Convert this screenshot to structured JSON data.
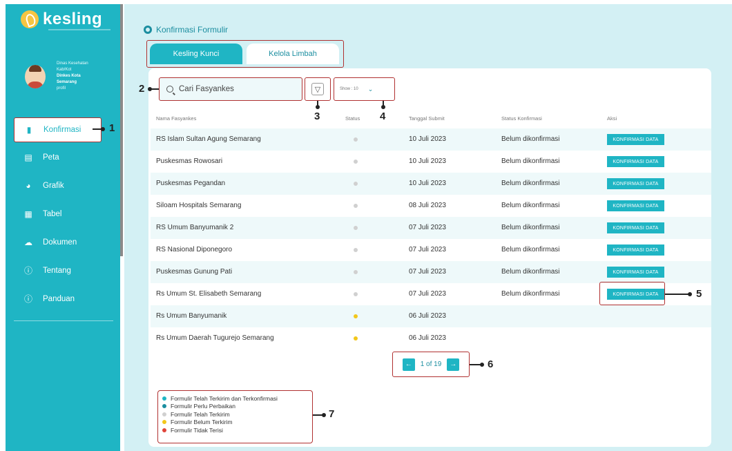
{
  "colors": {
    "accent": "#1fb5c4",
    "callout": "#b03030",
    "status_grey": "#d0d0d0",
    "status_yellow": "#f2c71b",
    "status_red": "#e0443a",
    "status_teal": "#1fb5c4"
  },
  "app": {
    "logo_text": "kesling"
  },
  "profile": {
    "line1": "Dinas Kesehatan",
    "line2": "Kab/Kot",
    "line3": "Dinkes Kota",
    "line4": "Semarang",
    "line5": "profil"
  },
  "sidebar": {
    "items": [
      {
        "label": "Konfirmasi",
        "icon": "confirm-icon"
      },
      {
        "label": "Peta",
        "icon": "map-icon"
      },
      {
        "label": "Grafik",
        "icon": "chart-icon"
      },
      {
        "label": "Tabel",
        "icon": "table-icon"
      },
      {
        "label": "Dokumen",
        "icon": "document-icon"
      },
      {
        "label": "Tentang",
        "icon": "info-icon"
      },
      {
        "label": "Panduan",
        "icon": "info-icon"
      }
    ]
  },
  "page": {
    "title": "Konfirmasi Formulir"
  },
  "tabs": [
    {
      "label": "Kesling Kunci"
    },
    {
      "label": "Kelola Limbah"
    }
  ],
  "search": {
    "placeholder": "Cari Fasyankes"
  },
  "show_select": {
    "value": "Show : 10"
  },
  "table": {
    "headers": [
      "Nama Fasyankes",
      "Status",
      "Tanggal Submit",
      "Status Konfirmasi",
      "Aksi"
    ],
    "action_label": "KONFIRMASI DATA",
    "rows": [
      {
        "name": "RS Islam Sultan Agung Semarang",
        "status": "grey",
        "date": "10 Juli 2023",
        "confirm": "Belum dikonfirmasi",
        "action": true
      },
      {
        "name": "Puskesmas Rowosari",
        "status": "grey",
        "date": "10 Juli 2023",
        "confirm": "Belum dikonfirmasi",
        "action": true
      },
      {
        "name": "Puskesmas Pegandan",
        "status": "grey",
        "date": "10 Juli 2023",
        "confirm": "Belum dikonfirmasi",
        "action": true
      },
      {
        "name": "Siloam Hospitals Semarang",
        "status": "grey",
        "date": "08 Juli 2023",
        "confirm": "Belum dikonfirmasi",
        "action": true
      },
      {
        "name": "RS Umum Banyumanik 2",
        "status": "grey",
        "date": "07 Juli 2023",
        "confirm": "Belum dikonfirmasi",
        "action": true
      },
      {
        "name": "RS Nasional Diponegoro",
        "status": "grey",
        "date": "07 Juli 2023",
        "confirm": "Belum dikonfirmasi",
        "action": true
      },
      {
        "name": "Puskesmas Gunung Pati",
        "status": "grey",
        "date": "07 Juli 2023",
        "confirm": "Belum dikonfirmasi",
        "action": true
      },
      {
        "name": "Rs Umum St. Elisabeth Semarang",
        "status": "grey",
        "date": "07 Juli 2023",
        "confirm": "Belum dikonfirmasi",
        "action": true
      },
      {
        "name": "Rs Umum Banyumanik",
        "status": "yellow",
        "date": "06 Juli 2023",
        "confirm": "",
        "action": false
      },
      {
        "name": "Rs Umum Daerah Tugurejo Semarang",
        "status": "yellow",
        "date": "06 Juli 2023",
        "confirm": "",
        "action": false
      }
    ]
  },
  "pagination": {
    "text": "1 of 19"
  },
  "legend": [
    {
      "label": "Formulir Telah Terkirim dan Terkonfirmasi",
      "color": "#1fb5c4"
    },
    {
      "label": "Formulir Perlu Perbaikan",
      "color": "#1b8ea0"
    },
    {
      "label": "Formulir Telah Terkirim",
      "color": "#d0d0d0"
    },
    {
      "label": "Formulir Belum Terkirim",
      "color": "#f2c71b"
    },
    {
      "label": "Formulir Tidak Terisi",
      "color": "#e0443a"
    }
  ],
  "callouts": [
    "1",
    "2",
    "3",
    "4",
    "5",
    "6",
    "7"
  ]
}
